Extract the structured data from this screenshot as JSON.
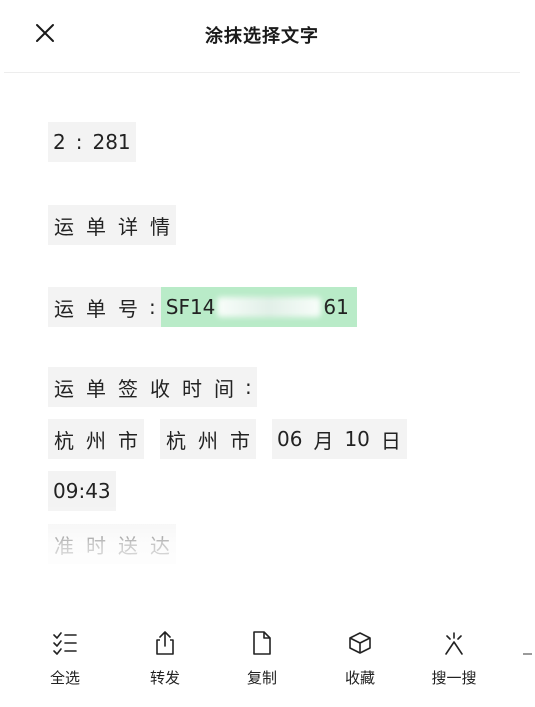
{
  "header": {
    "title": "涂抹选择文字",
    "close_icon": "close-icon"
  },
  "content": {
    "line1": {
      "t1": "2",
      "t2": ":",
      "t3": "281"
    },
    "line2": {
      "t1": "运",
      "t2": "单",
      "t3": "详",
      "t4": "情"
    },
    "line3": {
      "t1": "运",
      "t2": "单",
      "t3": "号",
      "t4": ":",
      "sel_start": "SF14",
      "sel_end": "61"
    },
    "line4": {
      "t1": "运",
      "t2": "单",
      "t3": "签",
      "t4": "收",
      "t5": "时",
      "t6": "间",
      "t7": ":"
    },
    "line5": {
      "t1": "杭",
      "t2": "州",
      "t3": "市",
      "t4": "杭",
      "t5": "州",
      "t6": "市",
      "t7": "06",
      "t8": "月",
      "t9": "10",
      "t10": "日"
    },
    "line6": {
      "t1": "09:43"
    },
    "line7": {
      "t1": "准",
      "t2": "时",
      "t3": "送",
      "t4": "达"
    }
  },
  "toolbar": {
    "select_all": "全选",
    "forward": "转发",
    "copy": "复制",
    "favorite": "收藏",
    "search": "搜一搜"
  },
  "colors": {
    "selection": "#b9ebc8",
    "token_bg": "#f3f3f3"
  }
}
